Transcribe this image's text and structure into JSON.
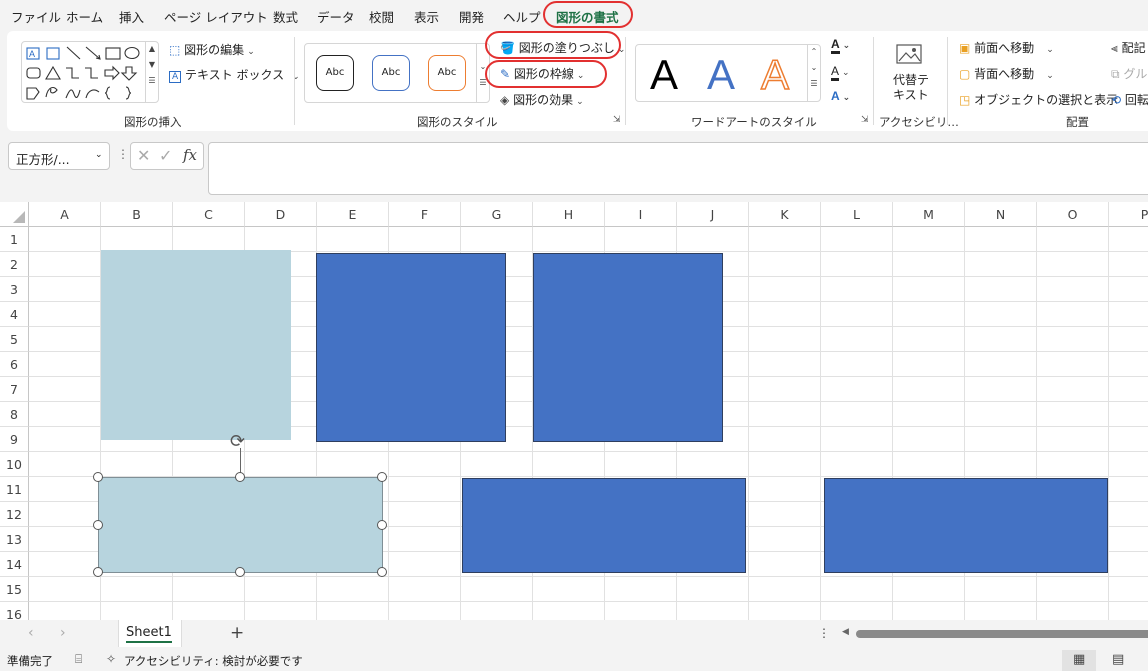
{
  "menu": {
    "tabs": [
      "ファイル",
      "ホーム",
      "挿入",
      "ページ レイアウト",
      "数式",
      "データ",
      "校閲",
      "表示",
      "開発",
      "ヘルプ"
    ],
    "active_tab": "図形の書式"
  },
  "ribbon": {
    "insert_shapes": {
      "edit_shape": "図形の編集",
      "text_box": "テキスト ボックス",
      "label": "図形の挿入"
    },
    "shape_styles": {
      "preset_text": "Abc",
      "fill": "図形の塗りつぶし",
      "outline": "図形の枠線",
      "effects": "図形の効果",
      "label": "図形のスタイル"
    },
    "wordart": {
      "letter": "A",
      "label": "ワードアートのスタイル"
    },
    "accessibility": {
      "alt_text_line1": "代替テ",
      "alt_text_line2": "キスト",
      "label": "アクセシビリ…"
    },
    "arrange": {
      "bring_forward": "前面へ移動",
      "send_backward": "背面へ移動",
      "selection_pane": "オブジェクトの選択と表示",
      "align": "配記",
      "group": "グル",
      "rotate": "回転",
      "label": "配置"
    }
  },
  "formula_bar": {
    "name_box": "正方形/...",
    "fx": "fx",
    "formula": ""
  },
  "grid": {
    "columns": [
      "A",
      "B",
      "C",
      "D",
      "E",
      "F",
      "G",
      "H",
      "I",
      "J",
      "K",
      "L",
      "M",
      "N",
      "O",
      "P"
    ],
    "rows": [
      "1",
      "2",
      "3",
      "4",
      "5",
      "6",
      "7",
      "8",
      "9",
      "10",
      "11",
      "12",
      "13",
      "14",
      "15",
      "16"
    ]
  },
  "shapes": {
    "light_fill": "#b7d4de",
    "blue_fill": "#4472c4",
    "blue_border": "#2f3f5f",
    "selected": "左下の長方形"
  },
  "sheet_tabs": {
    "active": "Sheet1",
    "add": "+"
  },
  "status": {
    "ready": "準備完了",
    "accessibility": "アクセシビリティ: 検討が必要です"
  },
  "colors": {
    "accent_green": "#1e7145",
    "highlight_red": "#e23030"
  }
}
